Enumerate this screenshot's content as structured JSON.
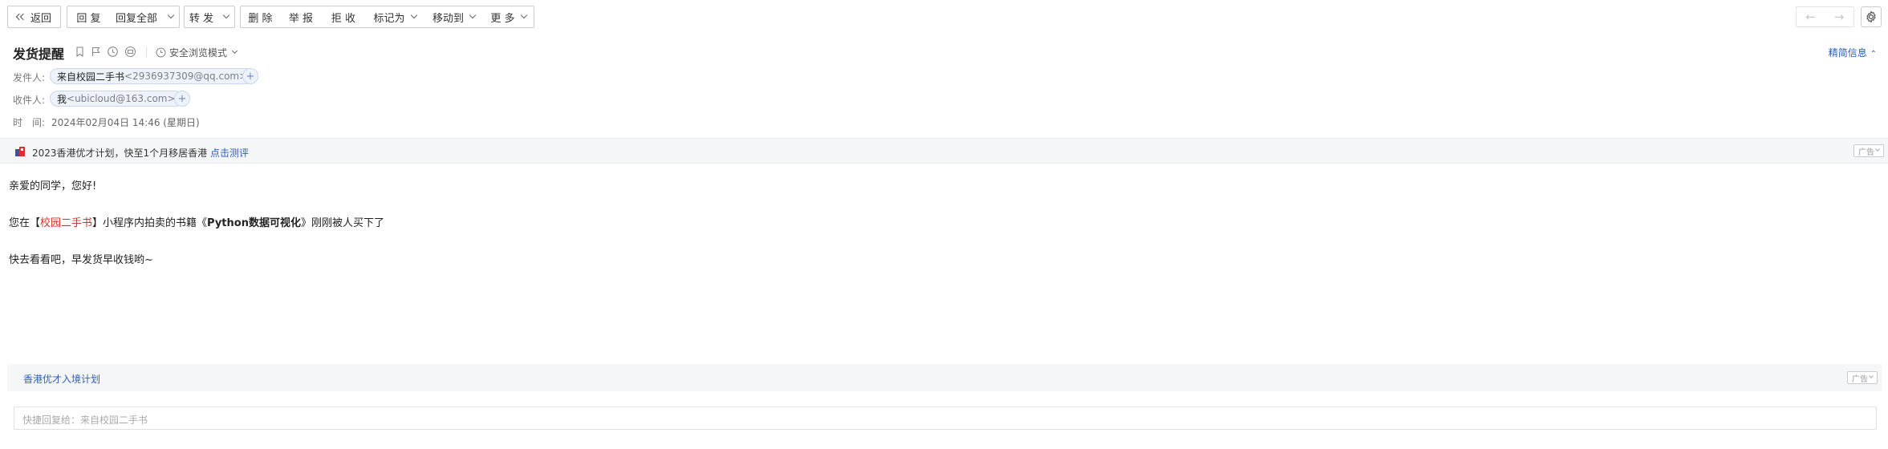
{
  "toolbar": {
    "back": "返回",
    "reply": "回 复",
    "reply_all": "回复全部",
    "forward": "转 发",
    "delete": "删 除",
    "report": "举 报",
    "reject": "拒 收",
    "mark_as": "标记为",
    "move_to": "移动到",
    "more": "更 多"
  },
  "header": {
    "subject": "发货提醒",
    "safe_mode": "安全浏览模式",
    "brief_info": "精简信息",
    "from_label": "发件人:",
    "from_name": "来自校园二手书",
    "from_addr": "<2936937309@qq.com>",
    "to_label": "收件人:",
    "to_name": "我",
    "to_addr": "<ubicloud@163.com>",
    "time_label": "时　间:",
    "time_value": "2024年02月04日 14:46 (星期日)"
  },
  "top_ad": {
    "text": "2023香港优才计划，快至1个月移居香港 ",
    "link": "点击测评",
    "tag": "广告"
  },
  "body": {
    "greeting": "亲爱的同学，您好!",
    "line2_pre": "您在【",
    "line2_brand": "校园二手书",
    "line2_mid": "】小程序内拍卖的书籍《",
    "line2_book": "Python数据可视化",
    "line2_post": "》刚刚被人买下了",
    "line3": "快去看看吧，早发货早收钱哟~"
  },
  "bottom_ad": {
    "link": "香港优才入境计划",
    "tag": "广告"
  },
  "quick_reply": {
    "placeholder": "快捷回复给：来自校园二手书"
  },
  "colors": {
    "link_blue": "#2c5fb6",
    "brand_red": "#d9322c",
    "chip_bg": "#eef3fb"
  }
}
